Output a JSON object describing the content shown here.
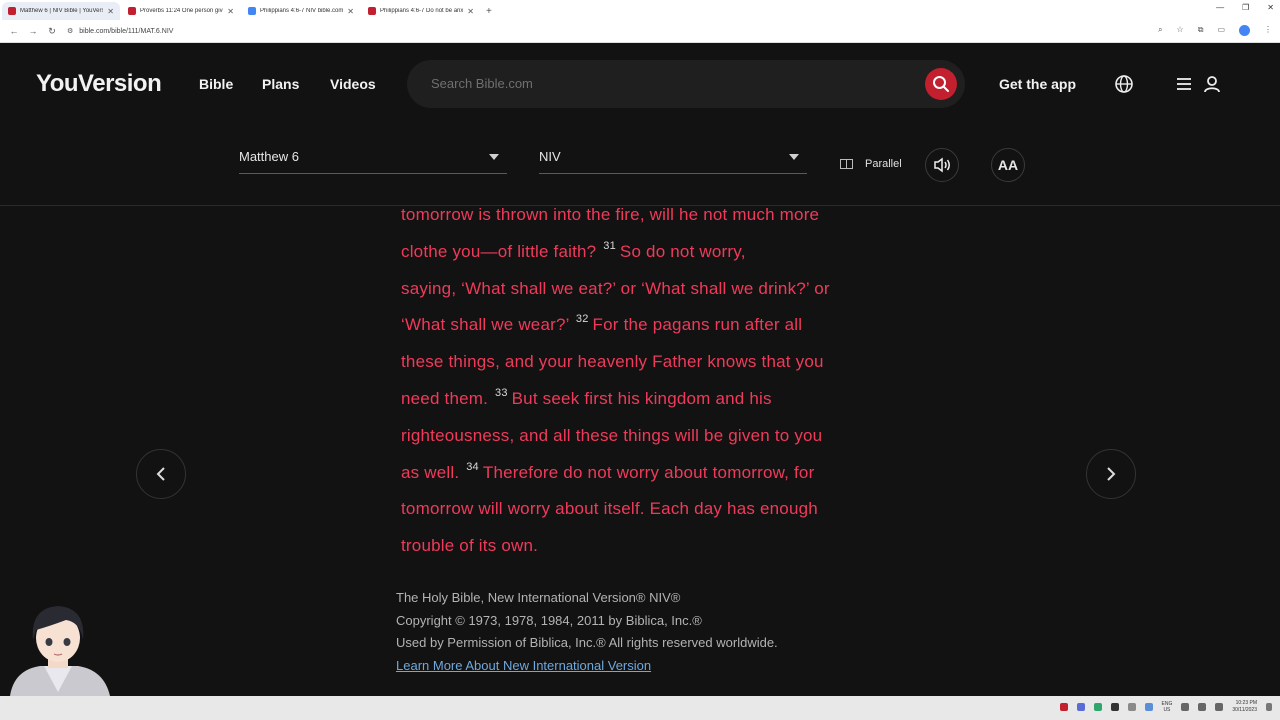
{
  "browser": {
    "tabs": [
      {
        "title": "Matthew 6 | NIV Bible | YouVers",
        "active": true,
        "color": "#c21f2f"
      },
      {
        "title": "Proverbs 11:24 One person give",
        "active": false,
        "color": "#c21f2f"
      },
      {
        "title": "Philippians 4:6-7 NIV bible.com",
        "active": false,
        "color": "#4285f4"
      },
      {
        "title": "Philippians 4:6-7 Do not be anx",
        "active": false,
        "color": "#c21f2f"
      }
    ],
    "url": "bible.com/bible/111/MAT.6.NIV"
  },
  "header": {
    "logo": "YouVersion",
    "nav": [
      "Bible",
      "Plans",
      "Videos"
    ],
    "search_placeholder": "Search Bible.com",
    "get_app": "Get the app",
    "search_button_color": "#c21f2f"
  },
  "toolbar": {
    "book_chapter": "Matthew 6",
    "version": "NIV",
    "parallel": "Parallel",
    "font_button": "AA"
  },
  "passage": {
    "color": "#f03a5a",
    "lines": [
      {
        "text": "tomorrow is thrown into the fire, will he not much more"
      },
      {
        "text": "clothe you—of little faith?",
        "verse": "31",
        "after": "So do not worry,"
      },
      {
        "text": "saying, ‘What shall we eat?’ or ‘What shall we drink?’ or"
      },
      {
        "text": "‘What shall we wear?’",
        "verse": "32",
        "after": "For the pagans run after all"
      },
      {
        "text": "these things, and your heavenly Father knows that you"
      },
      {
        "text": "need them.",
        "verse": "33",
        "after": "But seek first his kingdom and his"
      },
      {
        "text": "righteousness, and all these things will be given to you"
      },
      {
        "text": "as well.",
        "verse": "34",
        "after": "Therefore do not worry about tomorrow, for"
      },
      {
        "text": "tomorrow will worry about itself. Each day has enough"
      },
      {
        "text": "trouble of its own."
      }
    ]
  },
  "copyright": {
    "line1": "The Holy Bible, New International Version® NIV®",
    "line2": "Copyright © 1973, 1978, 1984, 2011 by Biblica, Inc.®",
    "line3": "Used by Permission of Biblica, Inc.® All rights reserved worldwide.",
    "link": "Learn More About New International Version"
  },
  "taskbar": {
    "lang_top": "ENG",
    "lang_bottom": "US",
    "time": "10:23 PM",
    "date": "30/11/2023"
  }
}
